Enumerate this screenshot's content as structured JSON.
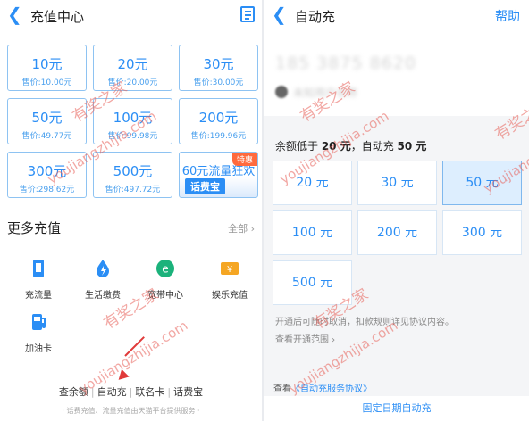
{
  "left": {
    "title": "充值中心",
    "tiles": [
      {
        "amount": "10元",
        "price": "售价:10.00元"
      },
      {
        "amount": "20元",
        "price": "售价:20.00元"
      },
      {
        "amount": "30元",
        "price": "售价:30.00元"
      },
      {
        "amount": "50元",
        "price": "售价:49.77元"
      },
      {
        "amount": "100元",
        "price": "售价:99.98元"
      },
      {
        "amount": "200元",
        "price": "售价:199.96元"
      },
      {
        "amount": "300元",
        "price": "售价:298.62元"
      },
      {
        "amount": "500元",
        "price": "售价:497.72元"
      }
    ],
    "special": {
      "flag": "特惠",
      "label": "60元流量狂欢",
      "brand": "话费宝"
    },
    "more_title": "更多充值",
    "all_label": "全部",
    "services": [
      {
        "label": "充流量",
        "icon": "data-card-icon"
      },
      {
        "label": "生活缴费",
        "icon": "water-drop-icon"
      },
      {
        "label": "宽带中心",
        "icon": "broadband-icon"
      },
      {
        "label": "娱乐充值",
        "icon": "ticket-icon"
      },
      {
        "label": "加油卡",
        "icon": "fuel-pump-icon"
      }
    ],
    "links": [
      "查余额",
      "自动充",
      "联名卡",
      "话费宝"
    ],
    "footer": "· 话费充值、流量充值由天猫平台提供服务 ·"
  },
  "right": {
    "title": "自动充",
    "help": "帮助",
    "phone_blurred": "185 3875 8620",
    "name_blurred": "未知用户名称",
    "rule_prefix": "余额低于 ",
    "rule_threshold": "20 元",
    "rule_mid": "，自动充 ",
    "rule_amount": "50 元",
    "options": [
      "20 元",
      "30 元",
      "50 元",
      "100 元",
      "200 元",
      "300 元",
      "500 元"
    ],
    "selected_option": "50 元",
    "note1": "开通后可随时取消，扣款规则详见协议内容。",
    "note2": "查看开通范围 ›",
    "agree_prefix": "查看",
    "agree_link": "《自动充服务协议》",
    "bottom_button": "固定日期自动充"
  },
  "watermark": {
    "brand_cn": "有奖之家",
    "url": "youjiangzhijia.com",
    "color": "#e8605a"
  },
  "colors": {
    "accent": "#2b8ef5",
    "selected_bg": "#ddeefe",
    "flag": "#ff6a3d",
    "annotation_arrow": "#e03a3a"
  }
}
